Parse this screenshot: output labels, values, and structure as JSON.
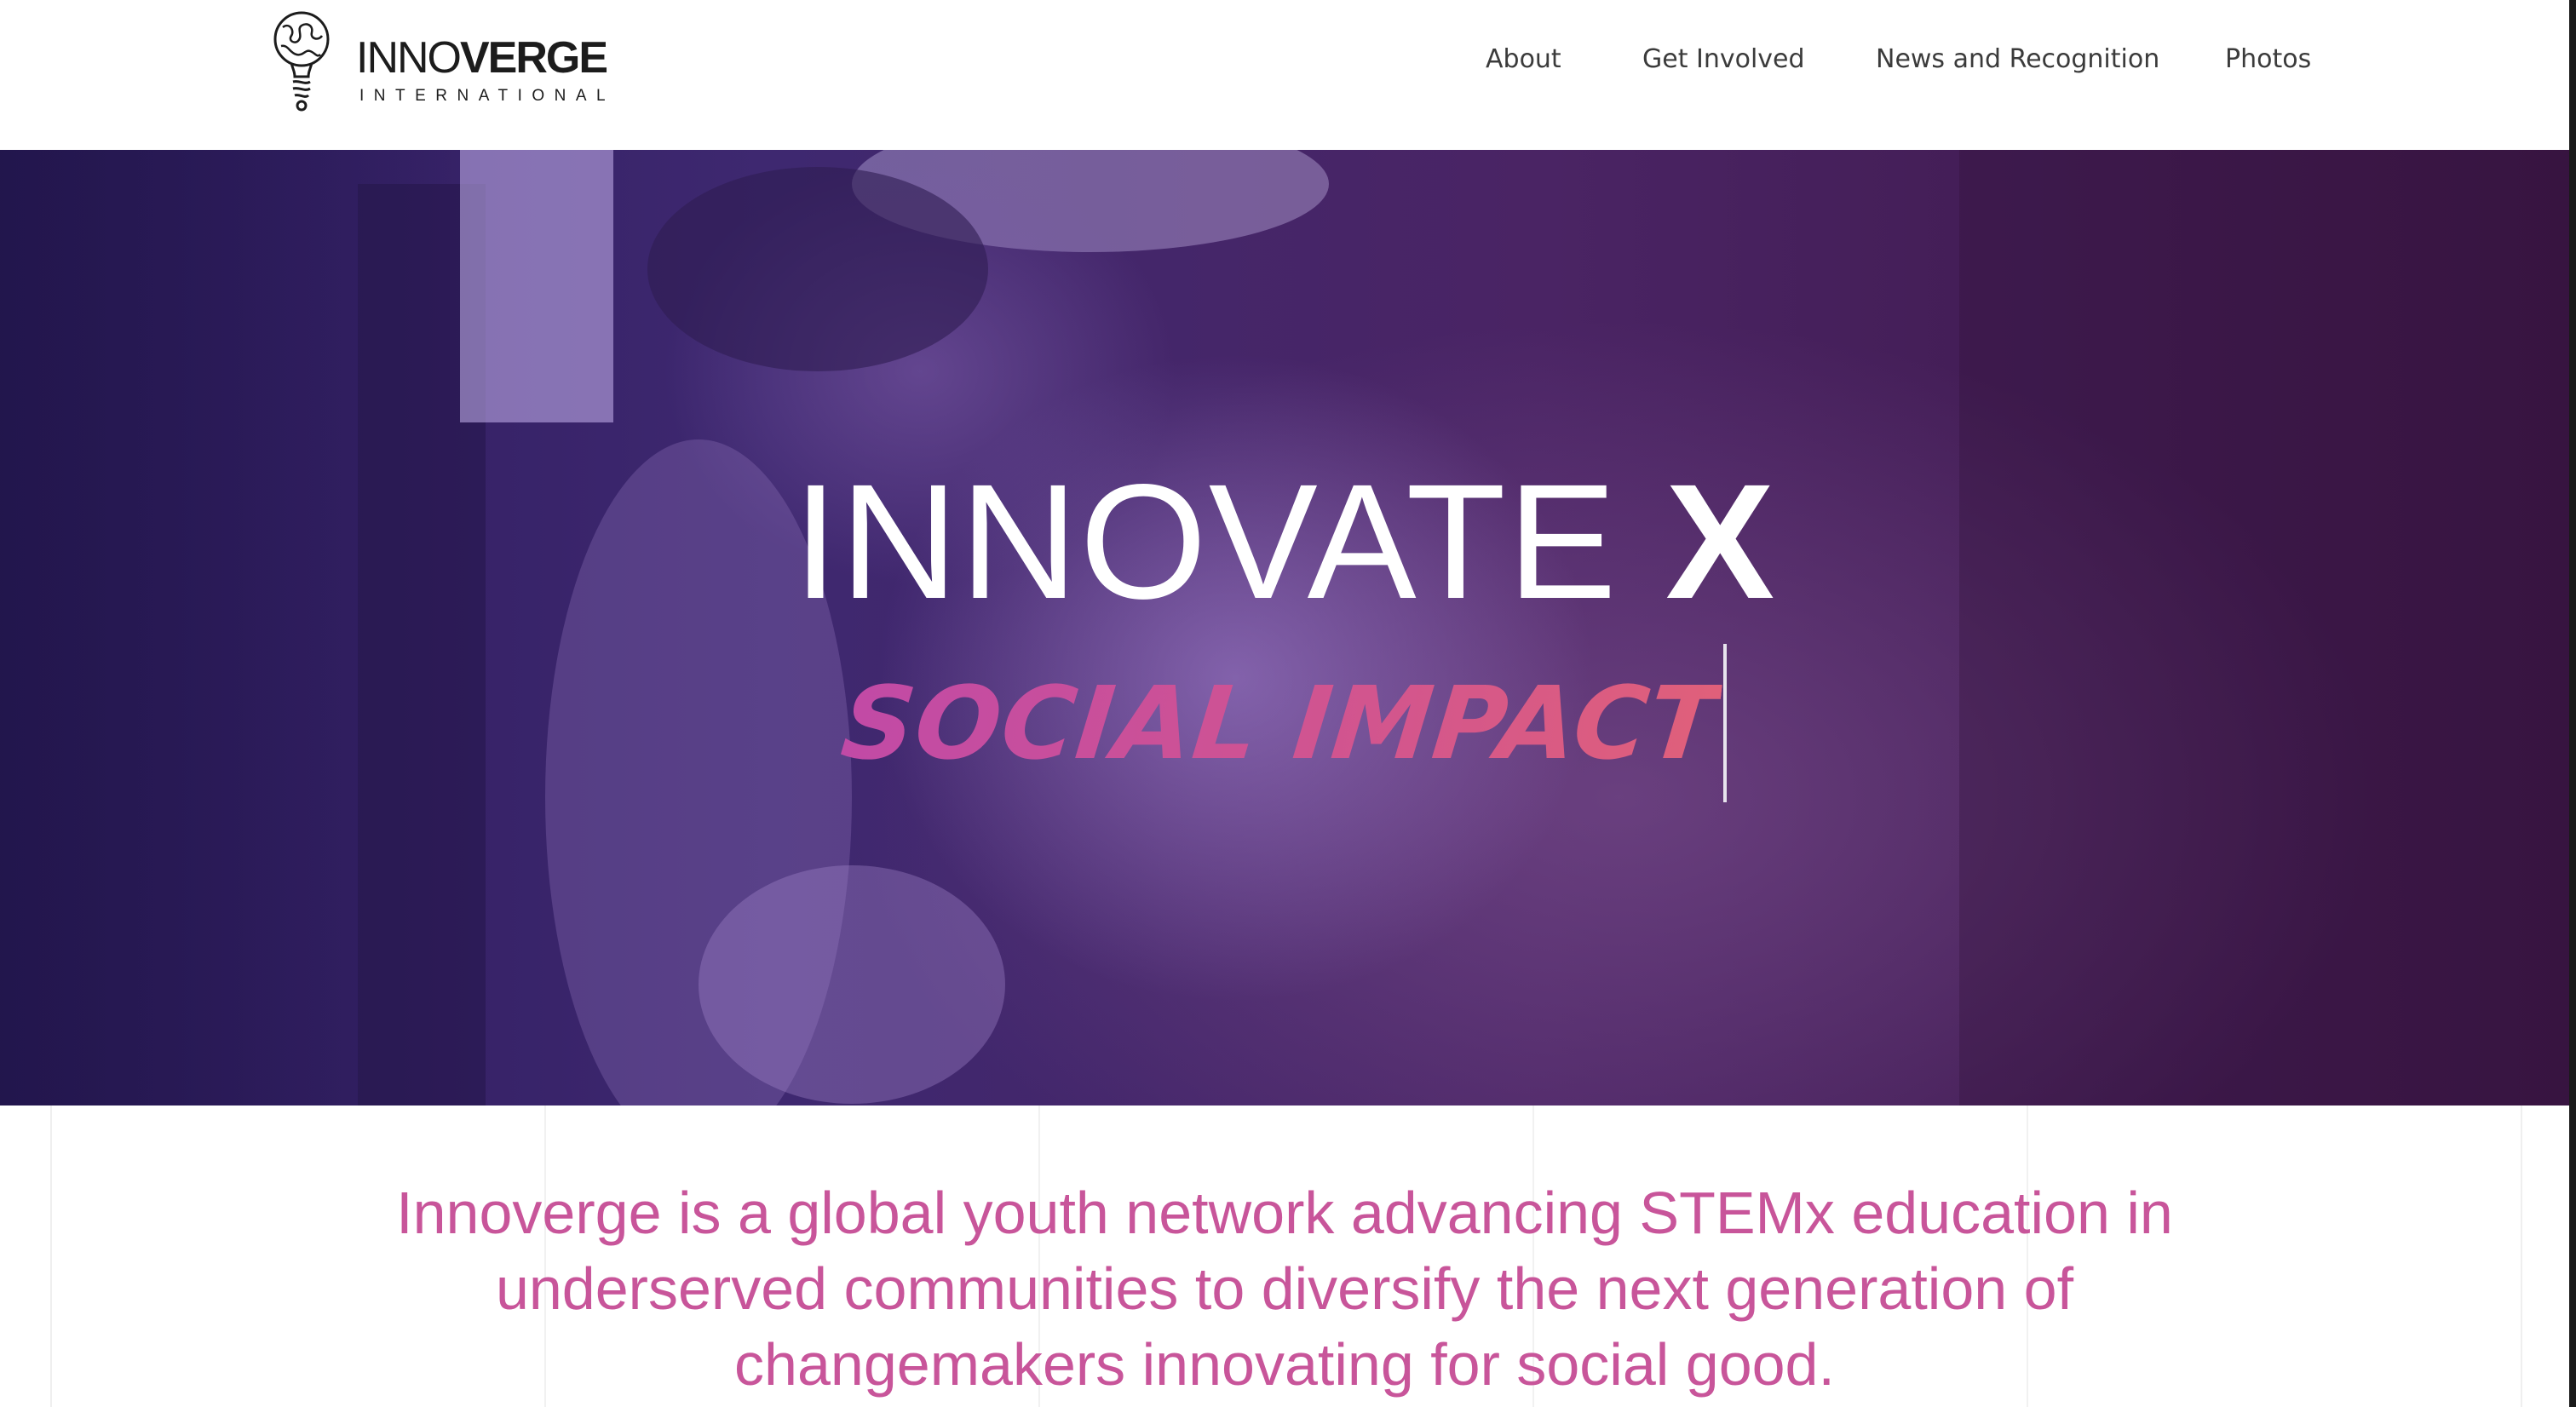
{
  "brand": {
    "word_light": "INNO",
    "word_bold": "VERGE",
    "tagline": "INTERNATIONAL",
    "logo_icon": "globe-lightbulb-icon"
  },
  "nav": {
    "items": [
      {
        "label": "About"
      },
      {
        "label": "Get Involved"
      },
      {
        "label": "News and Recognition"
      },
      {
        "label": "Photos"
      }
    ]
  },
  "hero": {
    "title_main": "INNOVATE",
    "title_x": "X",
    "subtitle": "SOCIAL IMPACT",
    "overlay_colors": [
      "#2c1a5c",
      "#4a2464",
      "#3c1646"
    ],
    "subtitle_color": "#c8559a"
  },
  "mission": {
    "text": "Innoverge is a global youth network advancing STEMx education in underserved communities to diversify the next generation of changemakers innovating for social good.",
    "color": "#c8559a"
  }
}
